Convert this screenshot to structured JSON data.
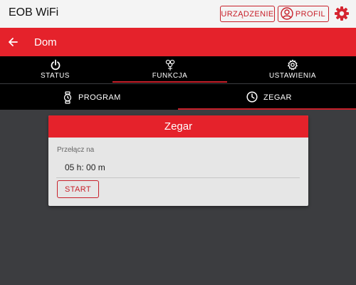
{
  "header": {
    "app_title": "EOB WiFi",
    "device_button": "URZĄDZENIE",
    "profile_button": "PROFIL",
    "accent": "#c8202a"
  },
  "navbar": {
    "title": "Dom",
    "background": "#e5222b"
  },
  "tabs": [
    {
      "label": "STATUS",
      "icon": "power-icon"
    },
    {
      "label": "FUNKCJA",
      "icon": "function-icon",
      "active": true
    },
    {
      "label": "USTAWIENIA",
      "icon": "gear-icon"
    }
  ],
  "subtabs": [
    {
      "label": "PROGRAM",
      "icon": "watch-icon"
    },
    {
      "label": "ZEGAR",
      "icon": "clock-icon",
      "active": true
    }
  ],
  "card": {
    "title": "Zegar",
    "field_label": "Przełącz na",
    "time_value": "05 h: 00 m",
    "start_button": "START"
  }
}
